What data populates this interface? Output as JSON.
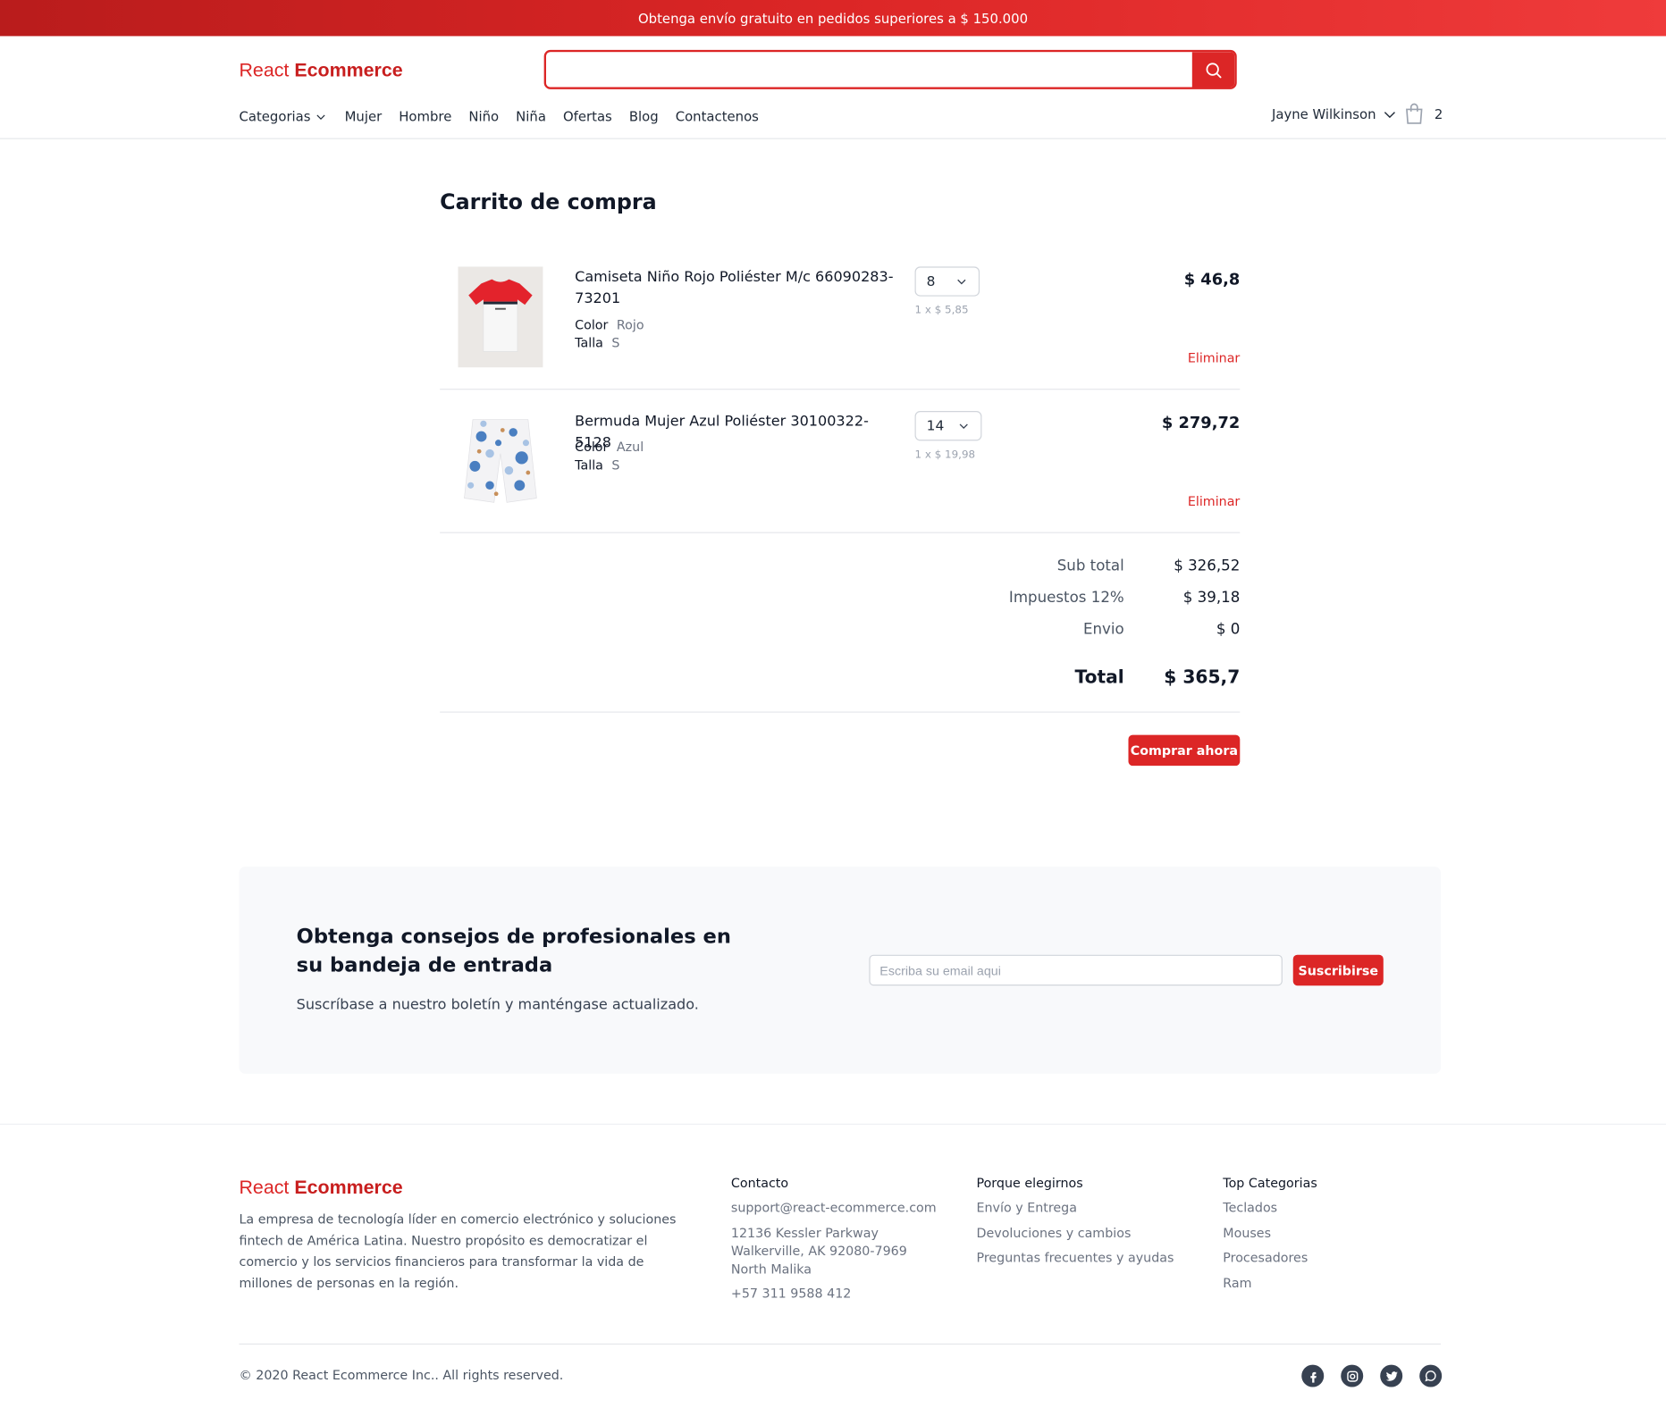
{
  "promo": {
    "text": "Obtenga envío gratuito en pedidos superiores a $ 150.000"
  },
  "header": {
    "logo_light": "React",
    "logo_bold": "Ecommerce",
    "search": {
      "value": "",
      "placeholder": ""
    },
    "nav": [
      "Categorias",
      "Mujer",
      "Hombre",
      "Niño",
      "Niña",
      "Ofertas",
      "Blog",
      "Contactenos"
    ],
    "user_name": "Jayne Wilkinson",
    "cart_count": "2"
  },
  "cart": {
    "title": "Carrito de compra",
    "items": [
      {
        "name": "Camiseta Niño Rojo Poliéster M/c 66090283-73201",
        "color_label": "Color",
        "color_value": "Rojo",
        "size_label": "Talla",
        "size_value": "S",
        "quantity": "8",
        "unit_price": "1 x $ 5,85",
        "price": "$ 46,8",
        "remove": "Eliminar"
      },
      {
        "name": "Bermuda Mujer Azul Poliéster 30100322-5128",
        "color_label": "Color",
        "color_value": "Azul",
        "size_label": "Talla",
        "size_value": "S",
        "quantity": "14",
        "unit_price": "1 x $ 19,98",
        "price": "$ 279,72",
        "remove": "Eliminar"
      }
    ],
    "summary": {
      "subtotal_label": "Sub total",
      "subtotal": "$ 326,52",
      "tax_label": "Impuestos 12%",
      "tax": "$ 39,18",
      "shipping_label": "Envio",
      "shipping": "$ 0",
      "total_label": "Total",
      "total": "$ 365,7"
    },
    "buy_label": "Comprar ahora"
  },
  "newsletter": {
    "title": "Obtenga consejos de profesionales en su bandeja de entrada",
    "subtitle": "Suscríbase a nuestro boletín y manténgase actualizado.",
    "email_placeholder": "Escriba su email aqui",
    "email_value": "",
    "button": "Suscribirse"
  },
  "footer": {
    "description": "La empresa de tecnología líder en comercio electrónico y soluciones fintech de América Latina. Nuestro propósito es democratizar el comercio y los servicios financieros para transformar la vida de millones de personas en la región.",
    "contact": {
      "heading": "Contacto",
      "email": "support@react-ecommerce.com",
      "address": "12136 Kessler Parkway Walkerville, AK 92080-7969 North Malika",
      "phone": "+57 311 9588 412"
    },
    "why": {
      "heading": "Porque elegirnos",
      "links": [
        "Envío y Entrega",
        "Devoluciones y cambios",
        "Preguntas frecuentes y ayudas"
      ]
    },
    "top": {
      "heading": "Top Categorias",
      "links": [
        "Teclados",
        "Mouses",
        "Procesadores",
        "Ram"
      ]
    },
    "copyright": "© 2020 React Ecommerce Inc.. All rights reserved.",
    "social_icons": [
      "facebook-icon",
      "instagram-icon",
      "twitter-icon",
      "whatsapp-icon"
    ]
  },
  "colors": {
    "accent": "#dc2626",
    "text": "#111827",
    "muted": "#6b7280",
    "panel": "#f8f9fb"
  }
}
